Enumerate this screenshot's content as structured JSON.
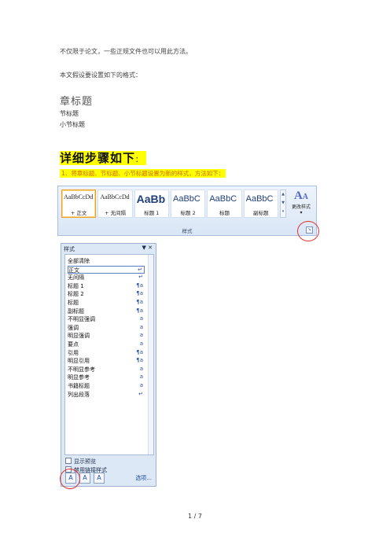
{
  "doc": {
    "intro_line1": "不仅限于论文，一些正规文件也可以用此方法。",
    "intro_line2": "本文假设要设置如下的格式：",
    "heading_chapter": "章标题",
    "heading_section": "节标题",
    "heading_subsection": "小节标题",
    "detail_title": "详细步骤如下",
    "detail_title_colon": "：",
    "step1": "1、将章标题、节标题、小节标题设置为新的样式，方法如下：",
    "page_number": "1 / 7"
  },
  "ribbon": {
    "gallery": [
      {
        "sample": "AaBbCcDd",
        "name": "+ 正文",
        "size": "small",
        "selected": true
      },
      {
        "sample": "AaBbCcDd",
        "name": "+ 无间隔",
        "size": "small",
        "selected": false
      },
      {
        "sample": "AaBb",
        "name": "标题 1",
        "size": "big",
        "selected": false
      },
      {
        "sample": "AaBbC",
        "name": "标题 2",
        "size": "med",
        "selected": false
      },
      {
        "sample": "AaBbC",
        "name": "标题",
        "size": "med",
        "selected": false
      },
      {
        "sample": "AaBbC",
        "name": "副标题",
        "size": "med",
        "selected": false
      }
    ],
    "change_styles_icon": "change-styles-icon",
    "change_styles_label": "更改样式",
    "group_label": "样式",
    "launcher_icon": "dialog-launcher-icon"
  },
  "styles_pane": {
    "title": "样式",
    "controls": "▼ ✕",
    "items": [
      {
        "label": "全部清除",
        "marker": ""
      },
      {
        "label": "正文",
        "marker": "↵",
        "selected": true
      },
      {
        "label": "无间隔",
        "marker": "↵"
      },
      {
        "label": "标题 1",
        "marker": "¶a"
      },
      {
        "label": "标题 2",
        "marker": "¶a"
      },
      {
        "label": "标题",
        "marker": "¶a"
      },
      {
        "label": "副标题",
        "marker": "¶a"
      },
      {
        "label": "不明显强调",
        "marker": "a"
      },
      {
        "label": "强调",
        "marker": "a"
      },
      {
        "label": "明显强调",
        "marker": "a"
      },
      {
        "label": "要点",
        "marker": "a"
      },
      {
        "label": "引用",
        "marker": "¶a"
      },
      {
        "label": "明显引用",
        "marker": "¶a"
      },
      {
        "label": "不明显参考",
        "marker": "a"
      },
      {
        "label": "明显参考",
        "marker": "a"
      },
      {
        "label": "书籍标题",
        "marker": "a"
      },
      {
        "label": "列出段落",
        "marker": "↵"
      }
    ],
    "show_preview": "显示预览",
    "disable_linked": "禁用链接样式",
    "buttons": [
      "new-style-icon",
      "style-inspector-icon",
      "manage-styles-icon"
    ],
    "options_label": "选项..."
  }
}
